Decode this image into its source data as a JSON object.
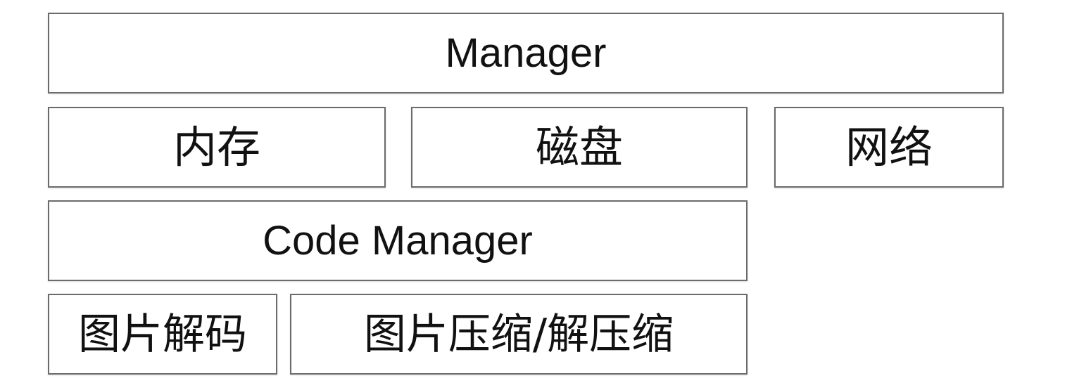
{
  "diagram": {
    "manager": "Manager",
    "memory": "内存",
    "disk": "磁盘",
    "network": "网络",
    "code_manager": "Code Manager",
    "image_decode": "图片解码",
    "image_compress": "图片压缩/解压缩"
  },
  "colors": {
    "border": "#6b6b6b",
    "text": "#111111",
    "background": "#ffffff"
  }
}
